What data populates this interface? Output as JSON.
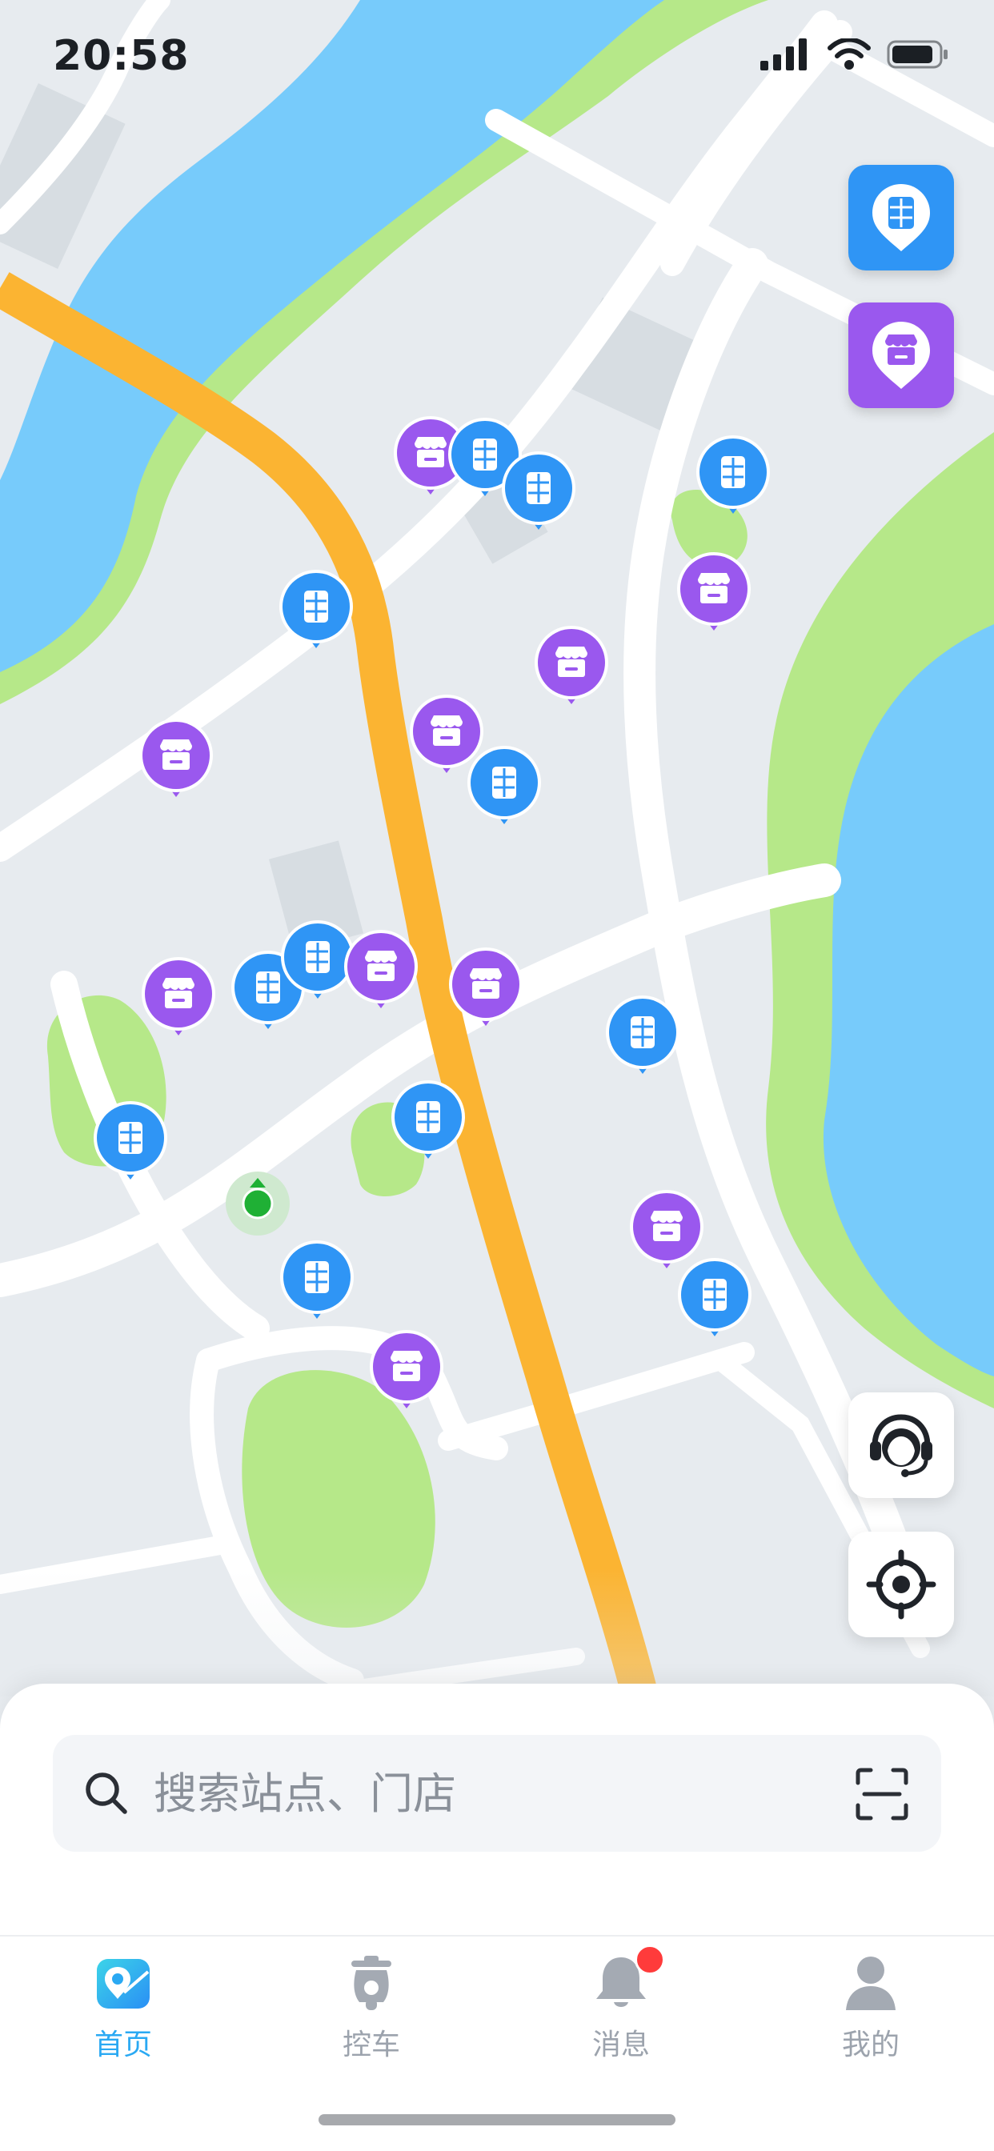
{
  "status_bar": {
    "time": "20:58"
  },
  "map": {
    "stations_layer_icon": "battery-station-icon",
    "stores_layer_icon": "store-icon",
    "user_location": "current-location-dot",
    "markers": [
      {
        "type": "store"
      },
      {
        "type": "station"
      },
      {
        "type": "station"
      },
      {
        "type": "station"
      },
      {
        "type": "store"
      },
      {
        "type": "station"
      },
      {
        "type": "store"
      },
      {
        "type": "store"
      },
      {
        "type": "store"
      },
      {
        "type": "station"
      },
      {
        "type": "store"
      },
      {
        "type": "station"
      },
      {
        "type": "station"
      },
      {
        "type": "store"
      },
      {
        "type": "store"
      },
      {
        "type": "station"
      },
      {
        "type": "station"
      },
      {
        "type": "station"
      },
      {
        "type": "store"
      },
      {
        "type": "station"
      },
      {
        "type": "station"
      },
      {
        "type": "store"
      }
    ]
  },
  "search": {
    "placeholder": "搜索站点、门店"
  },
  "tabs": [
    {
      "label": "首页",
      "icon": "home-map-icon",
      "active": true
    },
    {
      "label": "控车",
      "icon": "scooter-icon",
      "active": false
    },
    {
      "label": "消息",
      "icon": "bell-icon",
      "active": false,
      "badge": true
    },
    {
      "label": "我的",
      "icon": "user-icon",
      "active": false
    }
  ],
  "colors": {
    "station_blue": "#2f95f5",
    "store_purple": "#9a58ee",
    "road_orange": "#fbb432",
    "water": "#78cbfb",
    "park": "#b7e889",
    "accent": "#2aa9f3"
  }
}
